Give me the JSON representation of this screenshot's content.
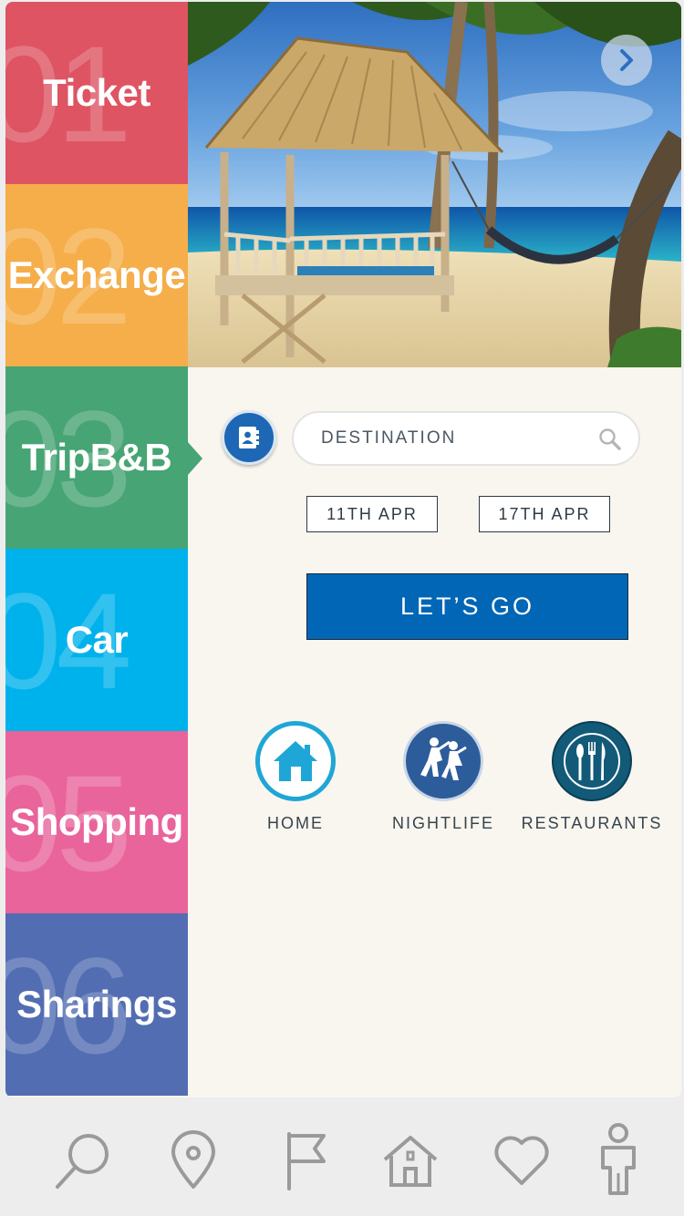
{
  "sidebar": {
    "items": [
      {
        "num": "01",
        "label": "Ticket",
        "color": "#de5463"
      },
      {
        "num": "02",
        "label": "Exchange",
        "color": "#f5ae4a"
      },
      {
        "num": "03",
        "label": "TripB&B",
        "color": "#47a474"
      },
      {
        "num": "04",
        "label": "Car",
        "color": "#00b2ec"
      },
      {
        "num": "05",
        "label": "Shopping",
        "color": "#e9649b"
      },
      {
        "num": "06",
        "label": "Sharings",
        "color": "#526db2"
      }
    ],
    "active_index": 2
  },
  "hero": {
    "icon": "chevron-right-icon"
  },
  "search": {
    "placeholder": "DESTINATION",
    "icon": "search-icon"
  },
  "contact": {
    "icon": "address-book-icon"
  },
  "dates": {
    "start": "11TH APR",
    "end": "17TH APR"
  },
  "cta": {
    "label": "LET’S GO"
  },
  "categories": [
    {
      "label": "HOME",
      "icon": "house-icon"
    },
    {
      "label": "NIGHTLIFE",
      "icon": "dancers-icon"
    },
    {
      "label": "RESTAURANTS",
      "icon": "cutlery-icon"
    }
  ],
  "tabbar": {
    "icons": [
      "search-icon",
      "location-pin-icon",
      "flag-icon",
      "house-icon",
      "heart-icon",
      "person-icon"
    ]
  },
  "colors": {
    "accent": "#0266b6",
    "panel_bg": "#f9f6ef",
    "tab_icon": "#9a9a9a"
  }
}
